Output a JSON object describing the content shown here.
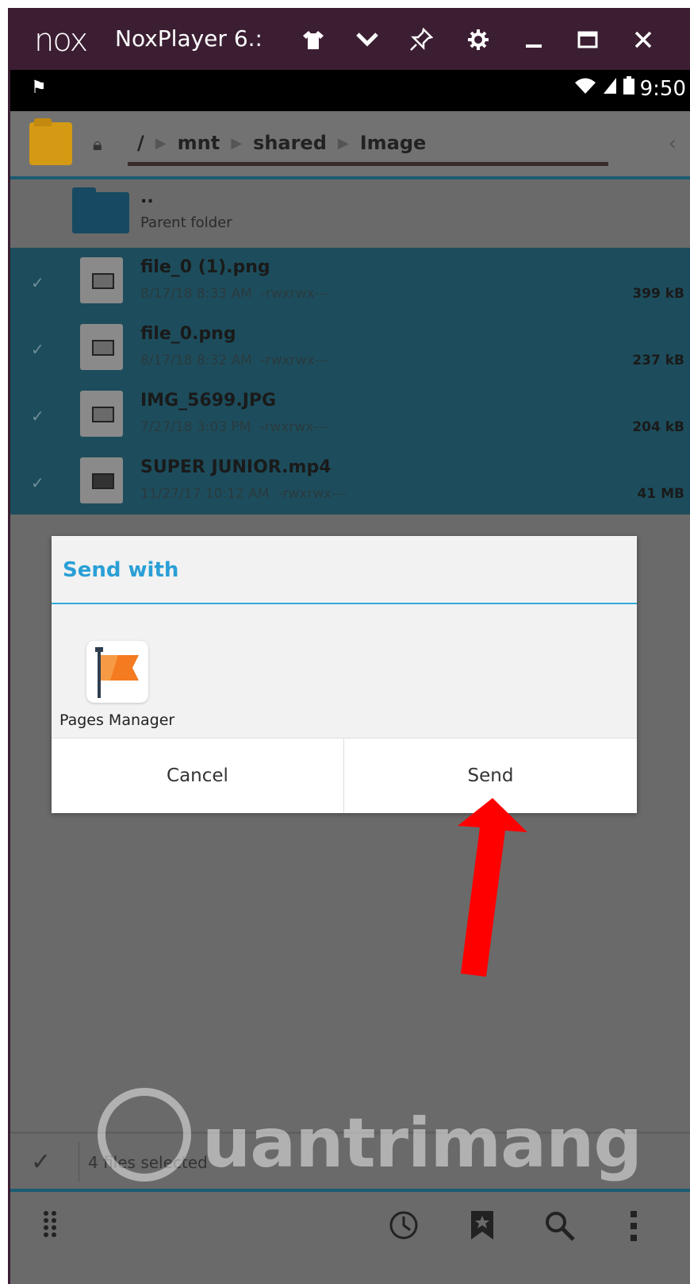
{
  "window": {
    "logo": "nox",
    "title": "NoxPlayer 6.:",
    "buttons": [
      "home-icon",
      "chevron-down-icon",
      "pin-icon",
      "gear-icon",
      "minimize-icon",
      "maximize-icon",
      "close-icon"
    ]
  },
  "statusbar": {
    "time": "9:50"
  },
  "path": {
    "segments": [
      "/",
      "mnt",
      "shared",
      "Image"
    ]
  },
  "files": {
    "parent": {
      "name": "..",
      "label": "Parent folder"
    },
    "items": [
      {
        "name": "file_0 (1).png",
        "date": "8/17/18 8:33 AM",
        "perms": "-rwxrwx---",
        "size": "399 kB",
        "type": "image"
      },
      {
        "name": "file_0.png",
        "date": "8/17/18 8:32 AM",
        "perms": "-rwxrwx---",
        "size": "237 kB",
        "type": "image"
      },
      {
        "name": "IMG_5699.JPG",
        "date": "7/27/18 3:03 PM",
        "perms": "-rwxrwx---",
        "size": "204 kB",
        "type": "image"
      },
      {
        "name": "SUPER JUNIOR.mp4",
        "date": "11/27/17 10:12 AM",
        "perms": "-rwxrwx---",
        "size": "41 MB",
        "type": "video"
      }
    ]
  },
  "dialog": {
    "title": "Send with",
    "app_label": "Pages Manager",
    "cancel_label": "Cancel",
    "send_label": "Send"
  },
  "selection": {
    "text": "4 files selected"
  },
  "watermark": {
    "text": "uantrimang"
  },
  "colors": {
    "accent": "#2a9fd6",
    "titlebar": "#3c1e32",
    "selected_row": "#1d4d5c",
    "arrow": "#ff0000"
  }
}
